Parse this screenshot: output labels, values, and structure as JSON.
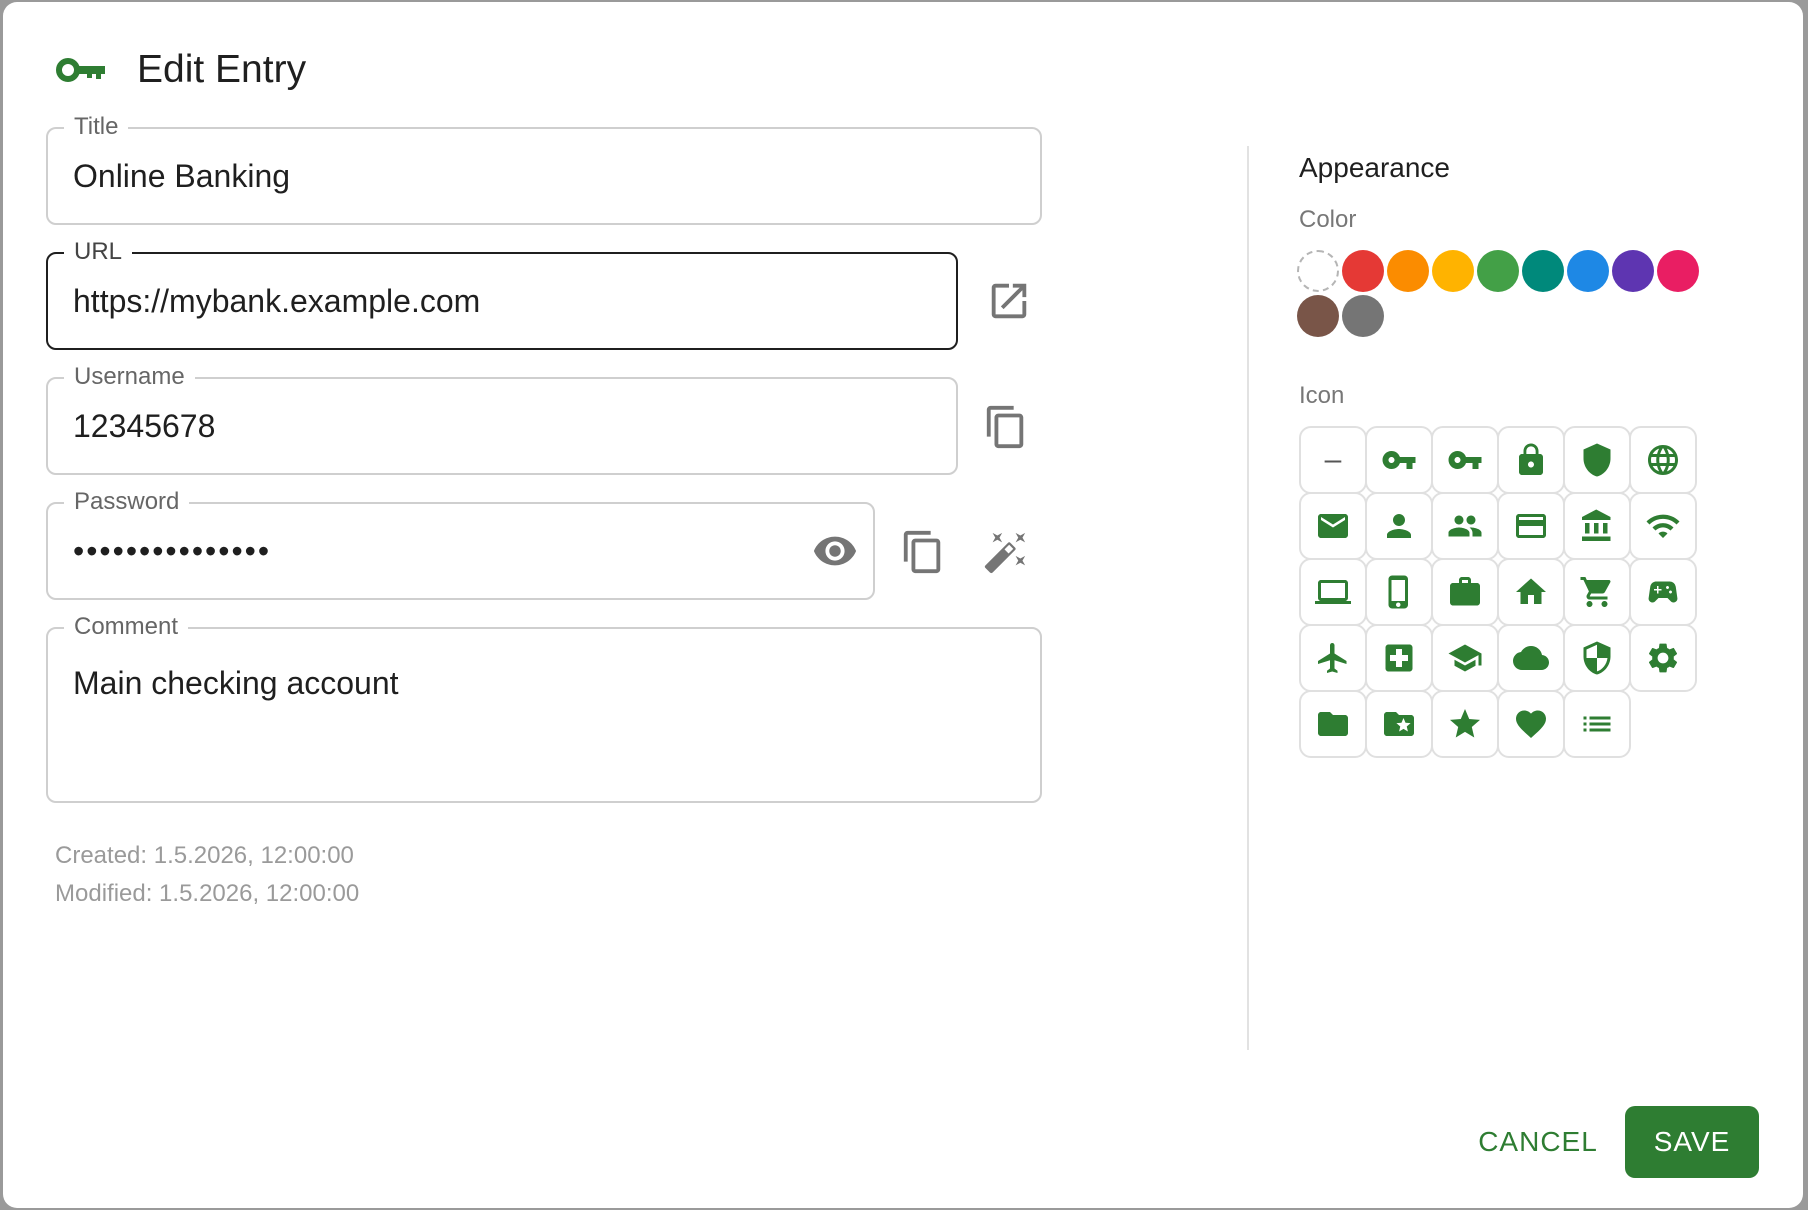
{
  "dialog": {
    "title": "Edit Entry",
    "title_icon": "key-icon"
  },
  "fields": {
    "title": {
      "label": "Title",
      "value": "Online Banking"
    },
    "url": {
      "label": "URL",
      "value": "https://mybank.example.com",
      "action_icon": "open-external-icon"
    },
    "username": {
      "label": "Username",
      "value": "12345678",
      "action_icon": "copy-icon"
    },
    "password": {
      "label": "Password",
      "value": "•••••••••••••••",
      "toggle_icon": "eye-icon",
      "copy_icon": "copy-icon",
      "generate_icon": "magic-wand-icon"
    },
    "comment": {
      "label": "Comment",
      "value": "Main checking account"
    }
  },
  "meta": {
    "created": "Created: 1.5.2026, 12:00:00",
    "modified": "Modified: 1.5.2026, 12:00:00"
  },
  "appearance": {
    "heading": "Appearance",
    "color_label": "Color",
    "icon_label": "Icon",
    "colors": [
      "none",
      "#e53935",
      "#fb8c00",
      "#ffb300",
      "#43a047",
      "#00897b",
      "#1e88e5",
      "#5e35b1",
      "#e91e63",
      "#795548",
      "#757575"
    ],
    "icons": [
      "none",
      "key-outline-icon",
      "key-icon",
      "lock-icon",
      "shield-icon",
      "globe-icon",
      "mail-icon",
      "person-icon",
      "people-icon",
      "credit-card-icon",
      "bank-icon",
      "wifi-icon",
      "laptop-icon",
      "phone-icon",
      "briefcase-icon",
      "home-icon",
      "cart-icon",
      "gamepad-icon",
      "airplane-icon",
      "medical-icon",
      "school-icon",
      "cloud-icon",
      "security-shield-icon",
      "settings-icon",
      "folder-icon",
      "folder-star-icon",
      "star-icon",
      "heart-icon",
      "list-icon"
    ],
    "none_icon_glyph": "–",
    "icon_color": "#2e7d32"
  },
  "actions": {
    "cancel": "CANCEL",
    "save": "SAVE"
  }
}
